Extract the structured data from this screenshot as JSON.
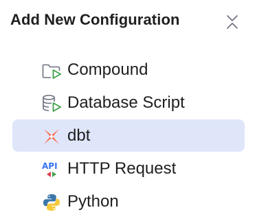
{
  "header": {
    "title": "Add New Configuration",
    "collapse_icon": "collapse-icon"
  },
  "items": [
    {
      "label": "Compound",
      "icon": "folder-run-icon",
      "selected": false
    },
    {
      "label": "Database Script",
      "icon": "database-run-icon",
      "selected": false
    },
    {
      "label": "dbt",
      "icon": "dbt-icon",
      "selected": true
    },
    {
      "label": "HTTP Request",
      "icon": "api-icon",
      "selected": false
    },
    {
      "label": "Python",
      "icon": "python-icon",
      "selected": false
    }
  ],
  "colors": {
    "selection": "#dfe6fa",
    "run_green": "#3fa14b",
    "dbt_orange": "#ff694b",
    "python_blue": "#3b76ab",
    "python_yellow": "#f6c93a",
    "api_blue": "#3574f0",
    "api_red": "#db3b4b",
    "api_green": "#3fa14b"
  }
}
